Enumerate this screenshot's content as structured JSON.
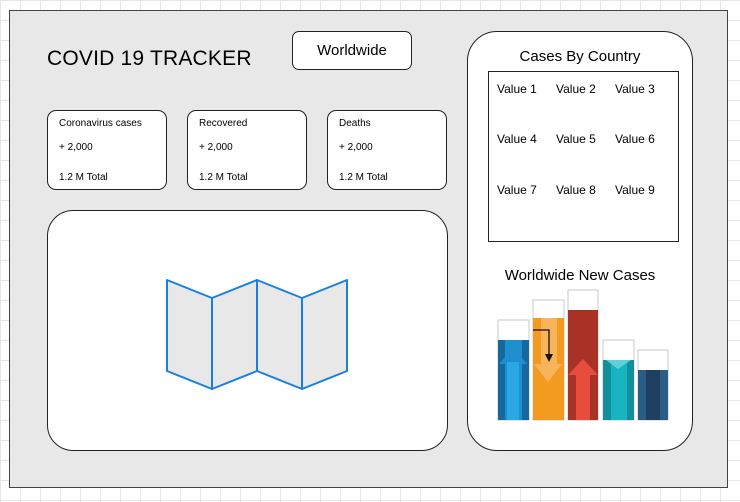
{
  "header": {
    "title": "COVID 19 TRACKER",
    "region_selector": "Worldwide"
  },
  "stats": [
    {
      "label": "Coronavirus cases",
      "new": "+ 2,000",
      "total": "1.2 M Total"
    },
    {
      "label": "Recovered",
      "new": "+ 2,000",
      "total": "1.2 M Total"
    },
    {
      "label": "Deaths",
      "new": "+ 2,000",
      "total": "1.2 M Total"
    }
  ],
  "map": {
    "icon": "folded-map-icon",
    "stroke_color": "#1a7fe0"
  },
  "sidebar": {
    "table_title": "Cases By Country",
    "table_cells": [
      "Value 1",
      "Value 2",
      "Value 3",
      "Value 4",
      "Value 5",
      "Value 6",
      "Value 7",
      "Value 8",
      "Value 9"
    ],
    "chart_title": "Worldwide New Cases"
  },
  "chart_icon": {
    "icon": "bar-chart-arrows-icon",
    "bar_colors": [
      "#1e8fcf",
      "#f39a21",
      "#c0392b",
      "#19b4c2",
      "#2c5d85"
    ]
  }
}
